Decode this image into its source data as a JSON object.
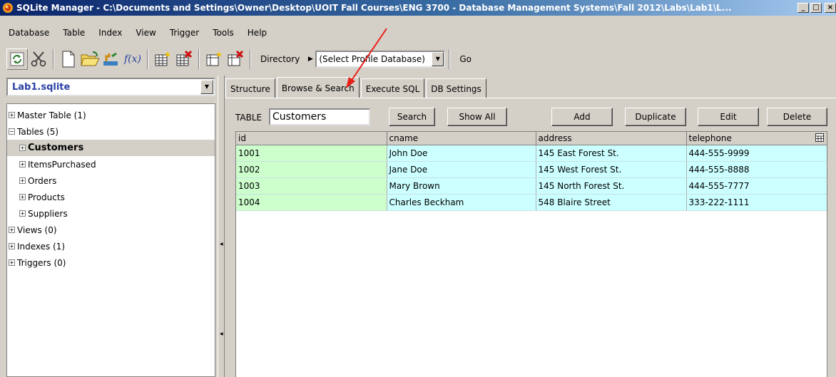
{
  "window": {
    "title": "SQLite Manager - C:\\Documents and Settings\\Owner\\Desktop\\UOIT Fall Courses\\ENG 3700 - Database Management Systems\\Fall 2012\\Labs\\Lab1\\L...",
    "minimize": "_",
    "maximize": "□",
    "close": "×"
  },
  "menubar": {
    "database": "Database",
    "table": "Table",
    "index": "Index",
    "view": "View",
    "trigger": "Trigger",
    "tools": "Tools",
    "help": "Help"
  },
  "toolbar": {
    "fx_label": "f(x)",
    "directory_label": "Directory",
    "profile_select_value": "(Select Profile Database)",
    "go_label": "Go"
  },
  "left_pane": {
    "db_select_value": "Lab1.sqlite",
    "tree": [
      {
        "label": "Master Table (1)",
        "expander": "+"
      },
      {
        "label": "Tables (5)",
        "expander": "−"
      },
      {
        "label": "Customers",
        "expander": "+"
      },
      {
        "label": "ItemsPurchased",
        "expander": "+"
      },
      {
        "label": "Orders",
        "expander": "+"
      },
      {
        "label": "Products",
        "expander": "+"
      },
      {
        "label": "Suppliers",
        "expander": "+"
      },
      {
        "label": "Views (0)",
        "expander": "+"
      },
      {
        "label": "Indexes (1)",
        "expander": "+"
      },
      {
        "label": "Triggers (0)",
        "expander": "+"
      }
    ]
  },
  "tabs": {
    "structure": "Structure",
    "browse_search": "Browse & Search",
    "execute_sql": "Execute SQL",
    "db_settings": "DB Settings",
    "active": "Browse & Search"
  },
  "browse": {
    "table_label": "TABLE",
    "table_value": "Customers",
    "search_label": "Search",
    "show_all_label": "Show All",
    "add_label": "Add",
    "duplicate_label": "Duplicate",
    "edit_label": "Edit",
    "delete_label": "Delete"
  },
  "grid": {
    "columns": [
      "id",
      "cname",
      "address",
      "telephone"
    ],
    "rows": [
      [
        "1001",
        "John Doe",
        "145 East Forest St.",
        "444-555-9999"
      ],
      [
        "1002",
        "Jane Doe",
        "145 West Forest St.",
        "444-555-8888"
      ],
      [
        "1003",
        "Mary Brown",
        "145 North Forest St.",
        "444-555-7777"
      ],
      [
        "1004",
        "Charles Beckham",
        "548 Blaire Street",
        "333-222-1111"
      ]
    ]
  },
  "colors": {
    "title_bar_start": "#0a246a",
    "id_cell_bg": "#ccffcc",
    "data_cell_bg": "#ccffff",
    "db_name_color": "#2b41a5",
    "annotation_arrow": "#e8201a"
  }
}
